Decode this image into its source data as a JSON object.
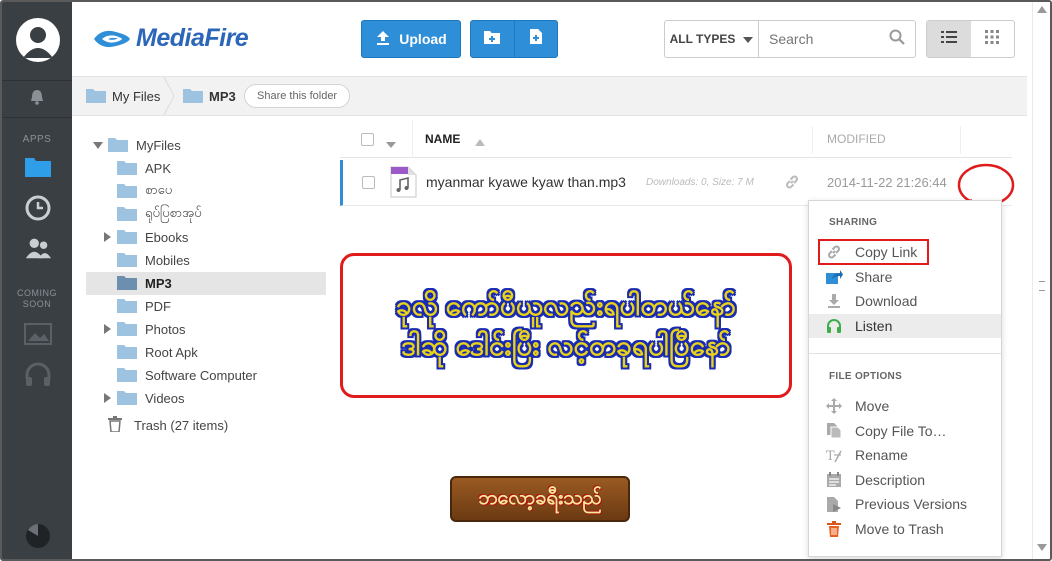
{
  "brand": {
    "name": "MediaFire"
  },
  "toolbar": {
    "upload_label": "Upload",
    "types_label": "ALL TYPES",
    "search_placeholder": "Search"
  },
  "rail": {
    "apps_label": "APPS",
    "coming_soon_label": "COMING SOON"
  },
  "breadcrumb": {
    "items": [
      {
        "label": "My Files"
      },
      {
        "label": "MP3"
      }
    ],
    "share_label": "Share this folder"
  },
  "tree": {
    "root": "MyFiles",
    "folders": [
      {
        "label": "APK",
        "expandable": false,
        "selected": false
      },
      {
        "label": "စာပေ",
        "expandable": false,
        "selected": false
      },
      {
        "label": "ရုပ်ပြစာအုပ်",
        "expandable": false,
        "selected": false
      },
      {
        "label": "Ebooks",
        "expandable": true,
        "selected": false
      },
      {
        "label": "Mobiles",
        "expandable": false,
        "selected": false
      },
      {
        "label": "MP3",
        "expandable": false,
        "selected": true
      },
      {
        "label": "PDF",
        "expandable": false,
        "selected": false
      },
      {
        "label": "Photos",
        "expandable": true,
        "selected": false
      },
      {
        "label": "Root Apk",
        "expandable": false,
        "selected": false
      },
      {
        "label": "Software Computer",
        "expandable": false,
        "selected": false
      },
      {
        "label": "Videos",
        "expandable": true,
        "selected": false
      }
    ],
    "trash_label": "Trash (27 items)"
  },
  "file_list": {
    "col_name": "NAME",
    "col_modified": "MODIFIED",
    "rows": [
      {
        "name": "myanmar kyawe kyaw than.mp3",
        "meta": "Downloads: 0, Size: 7 M",
        "modified": "2014-11-22 21:26:44"
      }
    ]
  },
  "context_menu": {
    "sharing_label": "SHARING",
    "sharing_items": [
      {
        "label": "Copy Link",
        "icon": "link-icon"
      },
      {
        "label": "Share",
        "icon": "share-icon"
      },
      {
        "label": "Download",
        "icon": "download-icon"
      },
      {
        "label": "Listen",
        "icon": "headphones-icon"
      }
    ],
    "file_options_label": "FILE OPTIONS",
    "file_items": [
      {
        "label": "Move",
        "icon": "move-icon"
      },
      {
        "label": "Copy File To…",
        "icon": "copy-icon"
      },
      {
        "label": "Rename",
        "icon": "rename-icon"
      },
      {
        "label": "Description",
        "icon": "description-icon"
      },
      {
        "label": "Previous Versions",
        "icon": "versions-icon"
      },
      {
        "label": "Move to Trash",
        "icon": "trash-icon"
      }
    ]
  },
  "annotation": {
    "line1": "ခုလို ကော်ပီယူလည်းရပါတယ်နော်",
    "line2": "ဒါဆို ဒေါင်းပြီး လင့်တခုရပါပြီနော်",
    "sign": "ဘလော့ခရီးသည်"
  },
  "colors": {
    "accent": "#2e8fd8",
    "rail": "#3a3f44",
    "annotation_red": "#e01b1b"
  }
}
